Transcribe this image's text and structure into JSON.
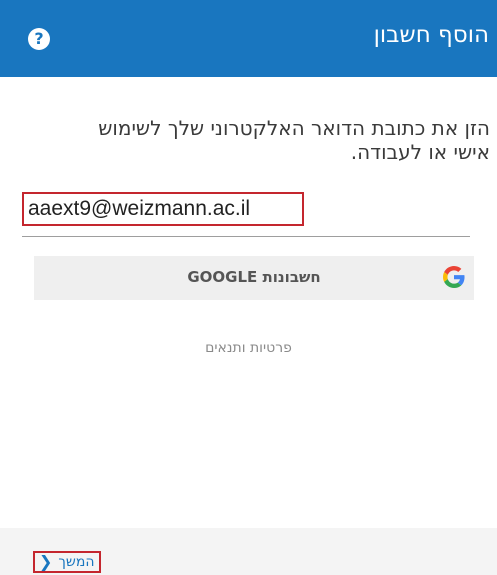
{
  "header": {
    "title": "הוסף חשבון",
    "help_icon": "question-circle-icon",
    "color": "#1976bf"
  },
  "prompt": {
    "line1": "הזן את כתובת הדואר האלקטרוני שלך לשימוש",
    "line2": "אישי או לעבודה."
  },
  "email": {
    "value": "aaext9@weizmann.ac.il"
  },
  "google": {
    "label": "חשבונות GOOGLE",
    "icon": "google-logo-icon"
  },
  "privacy": {
    "label": "פרטיות ותנאים"
  },
  "footer": {
    "next_label": "המשך",
    "next_icon": "chevron-left-icon",
    "highlight_color": "#c4262e"
  }
}
